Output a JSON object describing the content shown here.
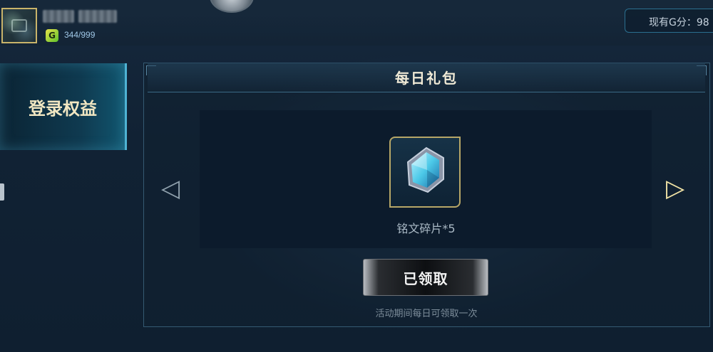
{
  "header": {
    "exp_text": "344/999",
    "g_score_text": "现有G分：98",
    "level_icon_glyph": "G"
  },
  "sidebar": {
    "items": [
      {
        "label": "登录权益",
        "active": true
      }
    ]
  },
  "panel": {
    "title": "每日礼包",
    "reward": {
      "icon": "crystal-fragment-icon",
      "name": "铭文碎片*5",
      "accent": "#4cc9e8"
    },
    "nav": {
      "prev_glyph": "◁",
      "next_glyph": "▷"
    },
    "claim_button_label": "已领取",
    "hint": "活动期间每日可领取一次"
  },
  "colors": {
    "background": "#112234",
    "gold_border": "#b7a767",
    "tab_accent": "#4fb3d4"
  }
}
